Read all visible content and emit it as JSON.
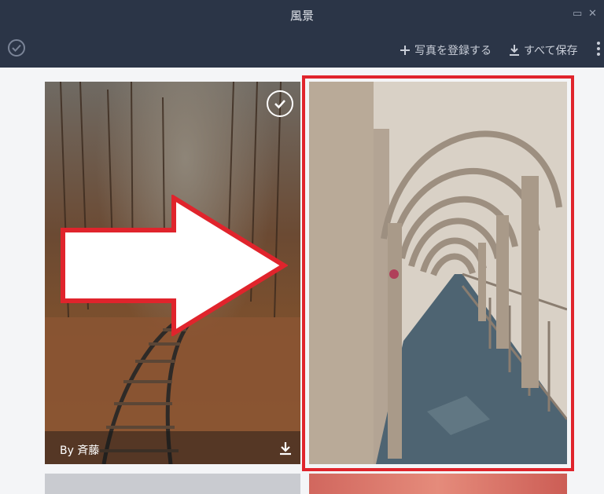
{
  "window": {
    "title": "風景"
  },
  "toolbar": {
    "add_photo_label": "写真を登録する",
    "save_all_label": "すべて保存"
  },
  "gallery": {
    "items": [
      {
        "caption": "By 斉藤",
        "selected": true
      },
      {
        "caption": "",
        "selected": false,
        "highlighted": true
      }
    ]
  },
  "icons": {
    "select_all": "check-circle-icon",
    "add": "plus-icon",
    "save": "download-icon",
    "menu": "kebab-menu-icon",
    "maximize": "maximize-icon",
    "close": "close-icon"
  },
  "colors": {
    "header": "#2b3547",
    "highlight_border": "#e0242c",
    "arrow_outline": "#e0242c",
    "arrow_fill": "#ffffff"
  }
}
